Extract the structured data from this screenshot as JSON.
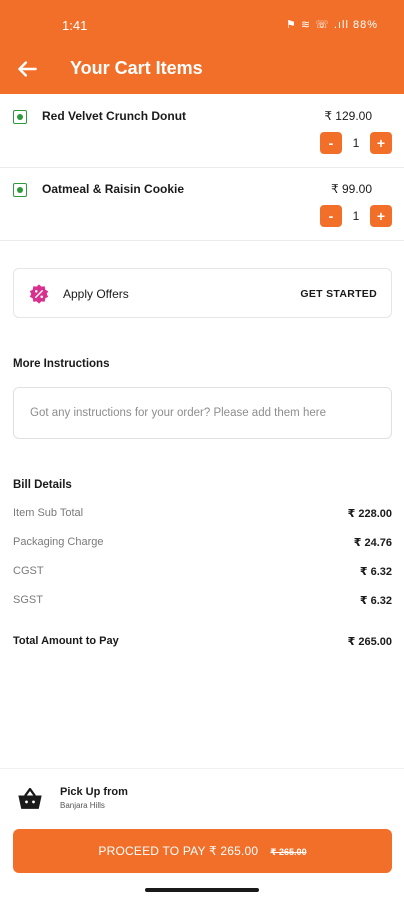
{
  "status_bar": {
    "time": "1:41",
    "icons_text": "⚑ ≋ ☏ .ıll 88%"
  },
  "header": {
    "title": "Your Cart Items",
    "back_icon": "arrow-left-icon"
  },
  "cart": {
    "items": [
      {
        "name": "Red Velvet Crunch Donut",
        "price": "₹ 129.00",
        "quantity": "1",
        "minus": "-",
        "plus": "+"
      },
      {
        "name": "Oatmeal & Raisin Cookie",
        "price": "₹ 99.00",
        "quantity": "1",
        "minus": "-",
        "plus": "+"
      }
    ]
  },
  "offers": {
    "label": "Apply Offers",
    "cta": "GET STARTED",
    "icon": "offer-badge-icon",
    "icon_color": "#d92f8f"
  },
  "instructions": {
    "title": "More Instructions",
    "placeholder": "Got any instructions for your order? Please add them here",
    "value": ""
  },
  "bill": {
    "title": "Bill Details",
    "rows": [
      {
        "label": "Item Sub Total",
        "value": "₹ 228.00"
      },
      {
        "label": "Packaging Charge",
        "value": "₹ 24.76"
      },
      {
        "label": "CGST",
        "value": "₹ 6.32"
      },
      {
        "label": "SGST",
        "value": "₹ 6.32"
      }
    ],
    "total": {
      "label": "Total Amount to Pay",
      "value": "₹ 265.00"
    }
  },
  "pickup": {
    "title": "Pick Up from",
    "location": "Banjara Hills",
    "icon": "basket-icon"
  },
  "proceed": {
    "label": "PROCEED TO PAY ₹ 265.00",
    "strike": "₹ 265.00"
  },
  "colors": {
    "accent": "#f26f2a",
    "veg": "#2e9a3b"
  }
}
